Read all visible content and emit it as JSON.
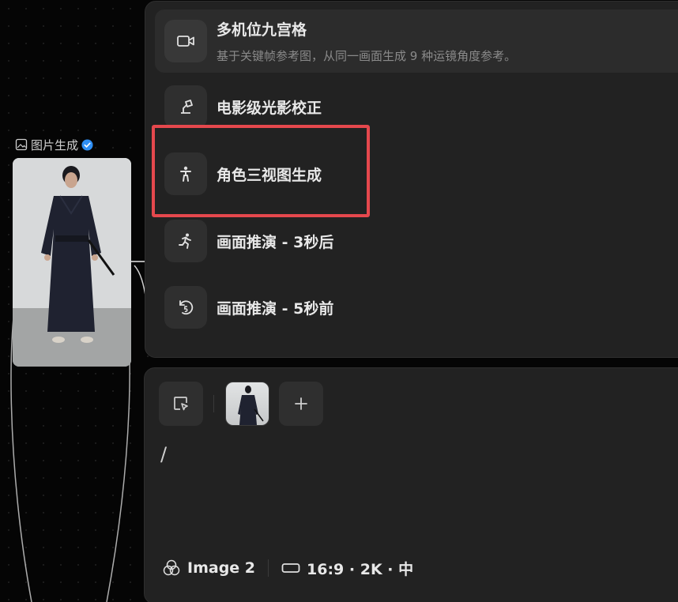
{
  "node": {
    "title": "图片生成",
    "verified": true
  },
  "menu": {
    "items": [
      {
        "icon": "video-camera-icon",
        "title": "多机位九宫格",
        "description": "基于关键帧参考图，从同一画面生成 9 种运镜角度参考。"
      },
      {
        "icon": "spotlight-icon",
        "title": "电影级光影校正"
      },
      {
        "icon": "person-standing-icon",
        "title": "角色三视图生成",
        "highlighted": true
      },
      {
        "icon": "running-person-icon",
        "title": "画面推演 - 3秒后"
      },
      {
        "icon": "rewind-5-icon",
        "title": "画面推演 - 5秒前"
      }
    ]
  },
  "composer": {
    "input_value": "/",
    "model": "Image 2",
    "settings": "16:9 · 2K · 中"
  },
  "colors": {
    "highlight": "#e5484d",
    "badge": "#2f8ff5",
    "panel": "#222222"
  }
}
